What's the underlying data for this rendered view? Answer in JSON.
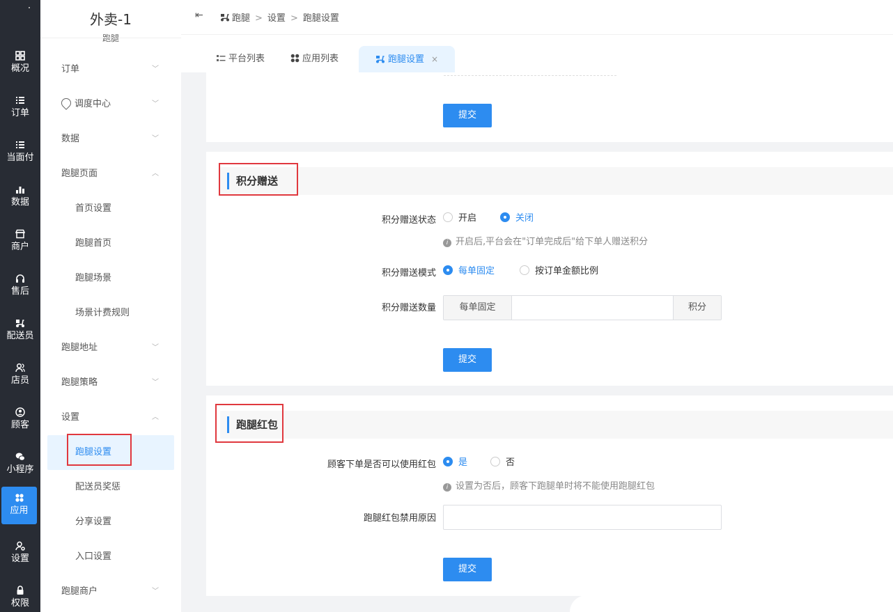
{
  "rail": {
    "items": [
      {
        "label": "概况",
        "icon": "dashboard-icon"
      },
      {
        "label": "订单",
        "icon": "list-icon"
      },
      {
        "label": "当面付",
        "icon": "list-icon"
      },
      {
        "label": "数据",
        "icon": "bar-chart-icon"
      },
      {
        "label": "商户",
        "icon": "store-icon"
      },
      {
        "label": "售后",
        "icon": "headset-icon"
      },
      {
        "label": "配送员",
        "icon": "scooter-icon"
      },
      {
        "label": "店员",
        "icon": "users-icon"
      },
      {
        "label": "顾客",
        "icon": "user-circle-icon"
      },
      {
        "label": "小程序",
        "icon": "wechat-icon"
      },
      {
        "label": "应用",
        "icon": "apps-icon"
      },
      {
        "label": "设置",
        "icon": "user-gear-icon"
      },
      {
        "label": "权限",
        "icon": "lock-icon"
      }
    ],
    "active": "应用"
  },
  "sidebar": {
    "title": "外卖-1",
    "subtitle": "跑腿",
    "items": [
      {
        "label": "订单",
        "chevron": "down"
      },
      {
        "label": "调度中心",
        "chevron": "down"
      },
      {
        "label": "数据",
        "chevron": "down"
      },
      {
        "label": "跑腿页面",
        "chevron": "up"
      },
      {
        "label": "首页设置"
      },
      {
        "label": "跑腿首页"
      },
      {
        "label": "跑腿场景"
      },
      {
        "label": "场景计费规则"
      },
      {
        "label": "跑腿地址",
        "chevron": "down"
      },
      {
        "label": "跑腿策略",
        "chevron": "down"
      },
      {
        "label": "设置",
        "chevron": "up"
      },
      {
        "label": "跑腿设置"
      },
      {
        "label": "配送员奖惩"
      },
      {
        "label": "分享设置"
      },
      {
        "label": "入口设置"
      },
      {
        "label": "跑腿商户",
        "chevron": "down"
      }
    ]
  },
  "header": {
    "breadcrumb": [
      "跑腿",
      "设置",
      "跑腿设置"
    ]
  },
  "tabs": [
    {
      "label": "平台列表",
      "icon": "list-icon"
    },
    {
      "label": "应用列表",
      "icon": "apps-icon"
    },
    {
      "label": "跑腿设置",
      "icon": "scooter-icon",
      "close": "×"
    }
  ],
  "form_top": {
    "submit": "提交"
  },
  "points": {
    "title": "积分赠送",
    "status_label": "积分赠送状态",
    "status_options": [
      "开启",
      "关闭"
    ],
    "status_selected": "关闭",
    "status_hint": "开启后,平台会在\"订单完成后\"给下单人赠送积分",
    "mode_label": "积分赠送模式",
    "mode_options": [
      "每单固定",
      "按订单金额比例"
    ],
    "mode_selected": "每单固定",
    "amount_label": "积分赠送数量",
    "amount_prefix": "每单固定",
    "amount_suffix": "积分",
    "amount_value": "",
    "submit": "提交"
  },
  "redpacket": {
    "title": "跑腿红包",
    "use_label": "顾客下单是否可以使用红包",
    "use_options": [
      "是",
      "否"
    ],
    "use_selected": "是",
    "use_hint": "设置为否后，顾客下跑腿单时将不能使用跑腿红包",
    "reason_label": "跑腿红包禁用原因",
    "reason_value": "",
    "submit": "提交"
  },
  "colors": {
    "accent": "#2d8cf0",
    "rail_bg": "#282c34",
    "highlight": "#e0383e"
  }
}
